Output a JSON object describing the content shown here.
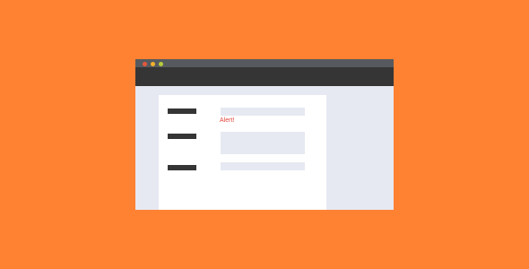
{
  "colors": {
    "background": "#ff8132",
    "titlebar": "#565a5e",
    "toolbar": "#353535",
    "viewport": "#e6e9f1",
    "card": "#ffffff",
    "label": "#353535",
    "field": "#e6e9f1",
    "alert": "#e5443b",
    "close_dot": "#e4573d",
    "minimize_dot": "#f2b12c",
    "maximize_dot": "#b6cc3a"
  },
  "window_controls": [
    "close",
    "minimize",
    "maximize"
  ],
  "form": {
    "alert_text": "Alert!"
  }
}
